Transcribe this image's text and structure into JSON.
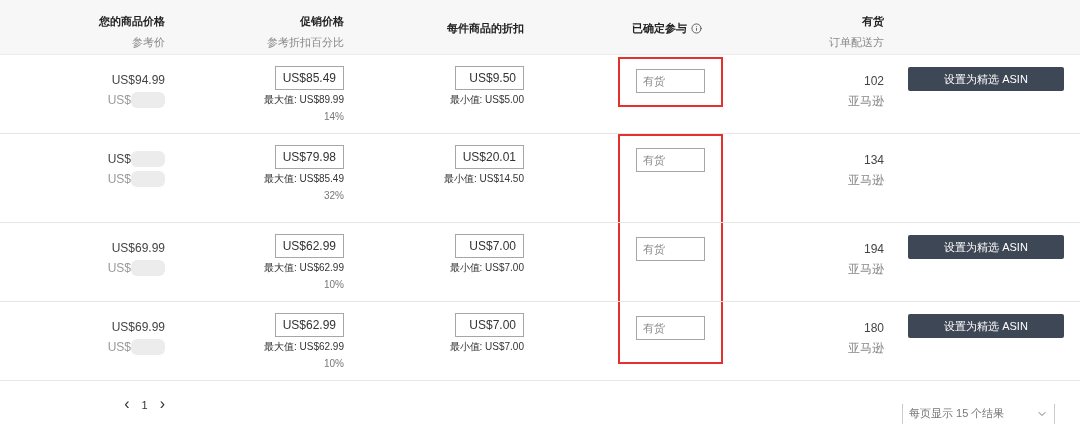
{
  "table": {
    "columns": [
      {
        "title": "您的商品价格",
        "subtitle": "参考价"
      },
      {
        "title": "促销价格",
        "subtitle": "参考折扣百分比"
      },
      {
        "title": "每件商品的折扣"
      },
      {
        "title": "已确定参与",
        "info": true
      },
      {
        "title": "有货",
        "subtitle": "订单配送方"
      },
      {}
    ],
    "rows": [
      {
        "your_price": {
          "text": "US$94.99",
          "redacted": false
        },
        "reference_price": {
          "text": "US$",
          "redacted": true
        },
        "promo_price": "US$85.49",
        "promo_max": "最大值: US$89.99",
        "discount_pct": "14%",
        "discount": "US$9.50",
        "discount_min": "最小值: US$5.00",
        "committed_placeholder": "有货",
        "kind": "single",
        "stock": "102",
        "fulfilled_by": "亚马逊",
        "button": "设置为精选 ASIN"
      },
      {
        "your_price": {
          "text": "US$",
          "redacted": true
        },
        "reference_price": {
          "text": "US$",
          "redacted": true
        },
        "promo_price": "US$79.98",
        "promo_max": "最大值: US$85.49",
        "discount_pct": "32%",
        "discount": "US$20.01",
        "discount_min": "最小值: US$14.50",
        "committed_placeholder": "有货",
        "kind": "start",
        "stock": "134",
        "fulfilled_by": "亚马逊"
      },
      {
        "your_price": {
          "text": "US$69.99",
          "redacted": false
        },
        "reference_price": {
          "text": "US$",
          "redacted": true
        },
        "promo_price": "US$62.99",
        "promo_max": "最大值: US$62.99",
        "discount_pct": "10%",
        "discount": "US$7.00",
        "discount_min": "最小值: US$7.00",
        "committed_placeholder": "有货",
        "kind": "middle",
        "stock": "194",
        "fulfilled_by": "亚马逊",
        "button": "设置为精选 ASIN"
      },
      {
        "your_price": {
          "text": "US$69.99",
          "redacted": false
        },
        "reference_price": {
          "text": "US$",
          "redacted": true
        },
        "promo_price": "US$62.99",
        "promo_max": "最大值: US$62.99",
        "discount_pct": "10%",
        "discount": "US$7.00",
        "discount_min": "最小值: US$7.00",
        "committed_placeholder": "有货",
        "kind": "end",
        "stock": "180",
        "fulfilled_by": "亚马逊",
        "button": "设置为精选 ASIN"
      }
    ]
  },
  "pagination": {
    "prev": "‹",
    "page": "1",
    "next": "›"
  },
  "page_size": {
    "label": "每页显示 15 个结果"
  }
}
